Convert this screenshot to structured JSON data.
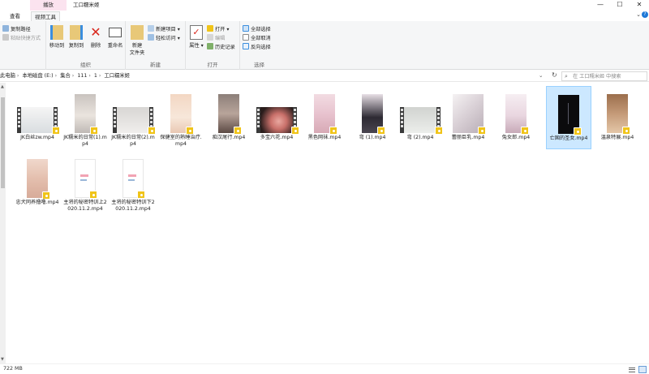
{
  "titlebar": {
    "context_tab": "播放",
    "title": "工口糯米姬",
    "min": "—",
    "max": "☐",
    "close": "✕"
  },
  "tabs": [
    {
      "label": "查看"
    },
    {
      "label": "视频工具"
    }
  ],
  "ribbon": {
    "clipboard": {
      "copy_path": "复制路径",
      "paste_shortcut": "粘贴快捷方式",
      "group": "组织"
    },
    "organize": {
      "move_to": "移动到",
      "copy_to": "复制到",
      "delete": "删除",
      "rename": "重命名"
    },
    "new": {
      "new_folder": "新建\n文件夹",
      "new_item": "新建项目",
      "easy_access": "轻松访问",
      "group": "新建"
    },
    "open": {
      "properties": "属性",
      "open": "打开",
      "edit": "编辑",
      "history": "历史记录",
      "group": "打开"
    },
    "select": {
      "select_all": "全部选择",
      "select_none": "全部取消",
      "invert": "反向选择",
      "group": "选择"
    }
  },
  "address": {
    "crumbs": [
      "此电脑",
      "本地磁盘 (E:)",
      "集合",
      "111",
      "1",
      "工口糯米姬"
    ],
    "search_placeholder": "在 工口糯米姬 中搜索"
  },
  "files": [
    {
      "name": "JK白丝zw.mp4",
      "selected": false
    },
    {
      "name": "JK糯米的日常(1).mp4",
      "selected": false
    },
    {
      "name": "JK糯米的日常(2).mp4",
      "selected": false
    },
    {
      "name": "保健室的熟睡治疗.mp4",
      "selected": false
    },
    {
      "name": "痴汉尾行.mp4",
      "selected": false
    },
    {
      "name": "多宝六花.mp4",
      "selected": false
    },
    {
      "name": "黑色网袜.mp4",
      "selected": false
    },
    {
      "name": "弯 (1).mp4",
      "selected": false
    },
    {
      "name": "弯 (2).mp4",
      "selected": false
    },
    {
      "name": "蕾丽巨乳.mp4",
      "selected": false
    },
    {
      "name": "兔女郎.mp4",
      "selected": false
    },
    {
      "name": "亡国的圣女.mp4",
      "selected": true
    },
    {
      "name": "温泉特展.mp4",
      "selected": false
    },
    {
      "name": "忠犬同养撸噜.mp4",
      "selected": false
    },
    {
      "name": "主将的秘密特训上2020.11.2.mp4",
      "selected": false
    },
    {
      "name": "主将的秘密特训下2020.11.2.mp4",
      "selected": false
    }
  ],
  "status": {
    "size_text": "722 MB"
  },
  "colors": {
    "accent": "#1e78d7",
    "selection": "#cce8ff",
    "context_tab": "#fbe3ef",
    "badge": "#f0c419"
  }
}
